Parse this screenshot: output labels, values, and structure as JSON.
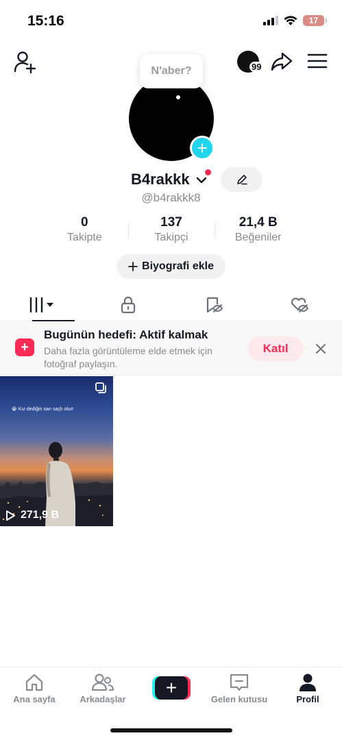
{
  "status_bar": {
    "time": "15:16",
    "battery": "17"
  },
  "top_nav": {
    "coin_count": "99"
  },
  "profile": {
    "bubble_text": "N'aber?",
    "username": "B4rakkk",
    "handle": "@b4rakkk8",
    "bio_button": "Biyografi ekle"
  },
  "stats": [
    {
      "value": "0",
      "label": "Takipte"
    },
    {
      "value": "137",
      "label": "Takipçi"
    },
    {
      "value": "21,4 B",
      "label": "Beğeniler"
    }
  ],
  "goal_banner": {
    "title": "Bugünün hedefi: Aktif kalmak",
    "description": "Daha fazla görüntüleme elde etmek için fotoğraf paylaşın.",
    "join_label": "Katıl"
  },
  "videos": [
    {
      "caption": "😭 Kız dediğin sarı saçlı olurr",
      "views": "271,9 B"
    }
  ],
  "bottom_nav": {
    "home": "Ana sayfa",
    "friends": "Arkadaşlar",
    "inbox": "Gelen kutusu",
    "profile": "Profil"
  },
  "colors": {
    "accent": "#fe2c55",
    "cyan": "#20d5ec",
    "text": "#161823",
    "muted": "#8a8b91"
  }
}
